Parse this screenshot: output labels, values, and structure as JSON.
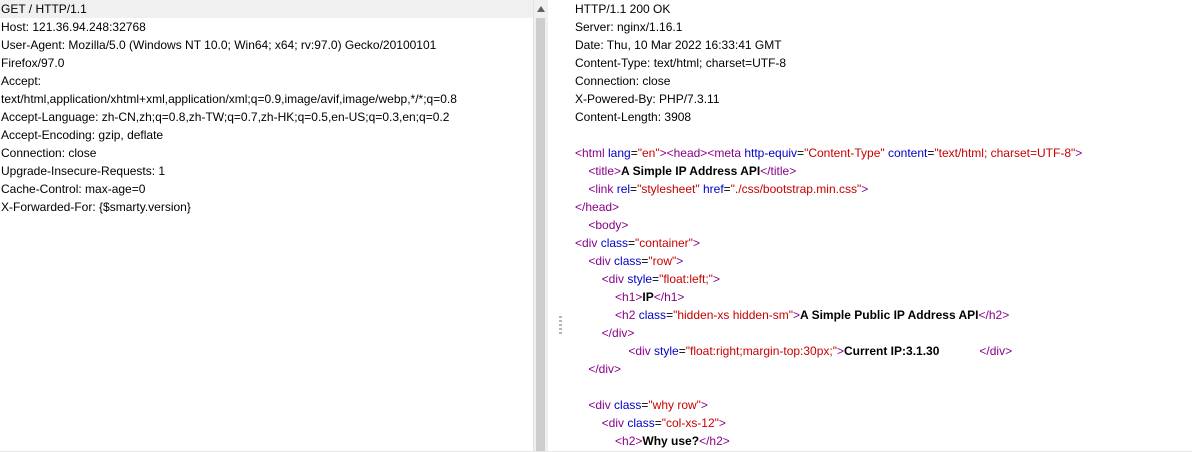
{
  "request": {
    "lines": [
      "GET / HTTP/1.1",
      "Host: 121.36.94.248:32768",
      "User-Agent: Mozilla/5.0 (Windows NT 10.0; Win64; x64; rv:97.0) Gecko/20100101",
      "Firefox/97.0",
      "Accept:",
      "text/html,application/xhtml+xml,application/xml;q=0.9,image/avif,image/webp,*/*;q=0.8",
      "Accept-Language: zh-CN,zh;q=0.8,zh-TW;q=0.7,zh-HK;q=0.5,en-US;q=0.3,en;q=0.2",
      "Accept-Encoding: gzip, deflate",
      "Connection: close",
      "Upgrade-Insecure-Requests: 1",
      "Cache-Control: max-age=0",
      "X-Forwarded-For: {$smarty.version}"
    ]
  },
  "response": {
    "headers": [
      "HTTP/1.1 200 OK",
      "Server: nginx/1.16.1",
      "Date: Thu, 10 Mar 2022 16:33:41 GMT",
      "Content-Type: text/html; charset=UTF-8",
      "Connection: close",
      "X-Powered-By: PHP/7.3.11",
      "Content-Length: 3908"
    ],
    "body": [
      [
        [
          "t",
          "<html "
        ],
        [
          "a",
          "lang"
        ],
        [
          "p",
          "="
        ],
        [
          "v",
          "\"en\""
        ],
        [
          "t",
          "><head><meta "
        ],
        [
          "a",
          "http-equiv"
        ],
        [
          "p",
          "="
        ],
        [
          "v",
          "\"Content-Type\""
        ],
        [
          "p",
          " "
        ],
        [
          "a",
          "content"
        ],
        [
          "p",
          "="
        ],
        [
          "v",
          "\"text/html; charset=UTF-8\""
        ],
        [
          "t",
          ">"
        ]
      ],
      [
        [
          "p",
          "    "
        ],
        [
          "t",
          "<title>"
        ],
        [
          "b",
          "A Simple IP Address API"
        ],
        [
          "t",
          "</title>"
        ]
      ],
      [
        [
          "p",
          "    "
        ],
        [
          "t",
          "<link "
        ],
        [
          "a",
          "rel"
        ],
        [
          "p",
          "="
        ],
        [
          "v",
          "\"stylesheet\""
        ],
        [
          "p",
          " "
        ],
        [
          "a",
          "href"
        ],
        [
          "p",
          "="
        ],
        [
          "v",
          "\"./css/bootstrap.min.css\""
        ],
        [
          "t",
          ">"
        ]
      ],
      [
        [
          "t",
          "</head>"
        ]
      ],
      [
        [
          "p",
          "    "
        ],
        [
          "t",
          "<body>"
        ]
      ],
      [
        [
          "t",
          "<div "
        ],
        [
          "a",
          "class"
        ],
        [
          "p",
          "="
        ],
        [
          "v",
          "\"container\""
        ],
        [
          "t",
          ">"
        ]
      ],
      [
        [
          "p",
          "    "
        ],
        [
          "t",
          "<div "
        ],
        [
          "a",
          "class"
        ],
        [
          "p",
          "="
        ],
        [
          "v",
          "\"row\""
        ],
        [
          "t",
          ">"
        ]
      ],
      [
        [
          "p",
          "        "
        ],
        [
          "t",
          "<div "
        ],
        [
          "a",
          "style"
        ],
        [
          "p",
          "="
        ],
        [
          "v",
          "\"float:left;\""
        ],
        [
          "t",
          ">"
        ]
      ],
      [
        [
          "p",
          "            "
        ],
        [
          "t",
          "<h1>"
        ],
        [
          "b",
          "IP"
        ],
        [
          "t",
          "</h1>"
        ]
      ],
      [
        [
          "p",
          "            "
        ],
        [
          "t",
          "<h2 "
        ],
        [
          "a",
          "class"
        ],
        [
          "p",
          "="
        ],
        [
          "v",
          "\"hidden-xs hidden-sm\""
        ],
        [
          "t",
          ">"
        ],
        [
          "b",
          "A Simple Public IP Address API"
        ],
        [
          "t",
          "</h2>"
        ]
      ],
      [
        [
          "p",
          "        "
        ],
        [
          "t",
          "</div>"
        ]
      ],
      [
        [
          "p",
          "                "
        ],
        [
          "t",
          "<div "
        ],
        [
          "a",
          "style"
        ],
        [
          "p",
          "="
        ],
        [
          "v",
          "\"float:right;margin-top:30px;\""
        ],
        [
          "t",
          ">"
        ],
        [
          "b",
          "Current IP:3.1.30"
        ],
        [
          "p",
          "            "
        ],
        [
          "t",
          "</div>"
        ]
      ],
      [
        [
          "p",
          "    "
        ],
        [
          "t",
          "</div>"
        ]
      ],
      [
        [
          "p",
          ""
        ]
      ],
      [
        [
          "p",
          "    "
        ],
        [
          "t",
          "<div "
        ],
        [
          "a",
          "class"
        ],
        [
          "p",
          "="
        ],
        [
          "v",
          "\"why row\""
        ],
        [
          "t",
          ">"
        ]
      ],
      [
        [
          "p",
          "        "
        ],
        [
          "t",
          "<div "
        ],
        [
          "a",
          "class"
        ],
        [
          "p",
          "="
        ],
        [
          "v",
          "\"col-xs-12\""
        ],
        [
          "t",
          ">"
        ]
      ],
      [
        [
          "p",
          "            "
        ],
        [
          "t",
          "<h2>"
        ],
        [
          "b",
          "Why use?"
        ],
        [
          "t",
          "</h2>"
        ]
      ]
    ]
  },
  "icons": {
    "scroll_up": "triangle-up-icon",
    "splitter": "drag-grip-icon"
  }
}
